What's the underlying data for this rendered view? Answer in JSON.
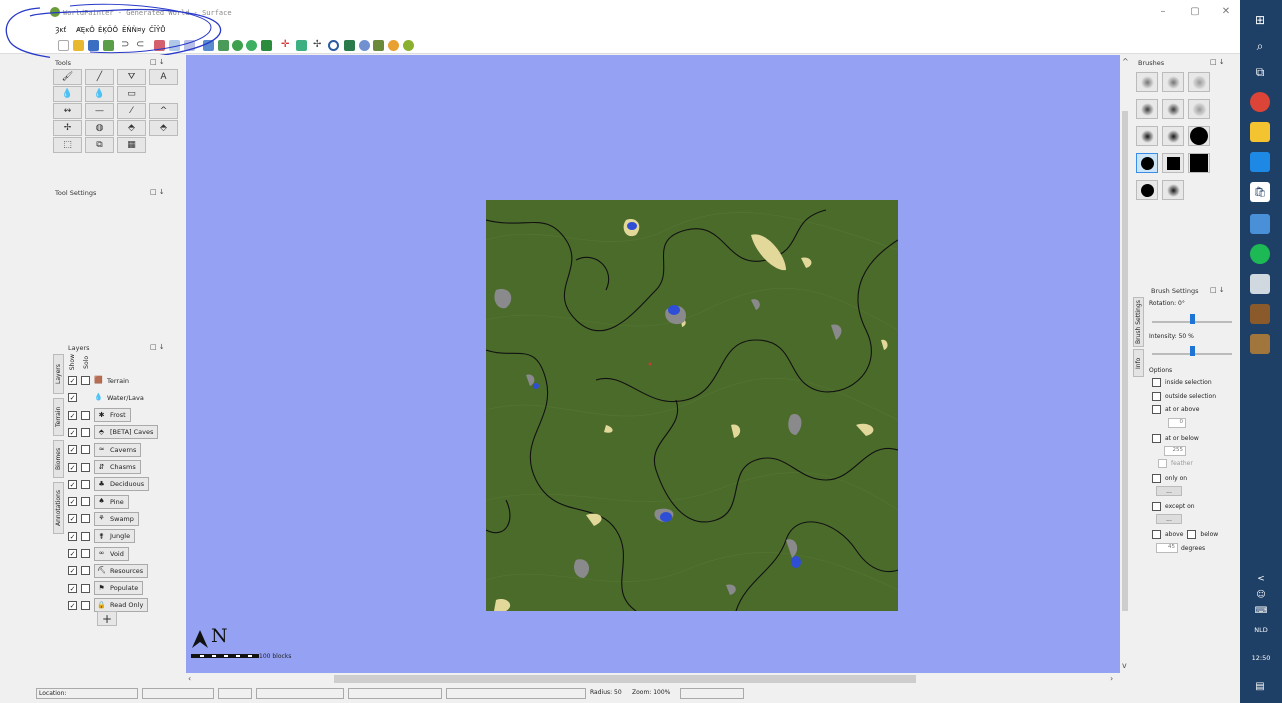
{
  "window": {
    "title": "WorldPainter - Generated World - Surface",
    "controls": [
      "–",
      "▢",
      "✕"
    ]
  },
  "menu": [
    "Ȝĸť",
    "ȺĘĸȎ",
    "ĚĶÕȎ",
    "ĔŃŇ¤y",
    "ČĪŶŮ"
  ],
  "panels": {
    "tools_title": "Tools",
    "tool_settings_title": "Tool Settings",
    "layers_title": "Layers",
    "brushes_title": "Brushes",
    "brush_settings_title": "Brush Settings",
    "panel_controls": "□ ↓"
  },
  "tools": [
    [
      "🖌",
      "╱",
      "⛛",
      "A"
    ],
    [
      "💧",
      "💧",
      "▭"
    ],
    [
      "↭",
      "—",
      "⁄",
      "^"
    ],
    [
      "✢",
      "◍",
      "⬘",
      "⬘"
    ],
    [
      "⬚",
      "⧉",
      "▦"
    ]
  ],
  "layers": {
    "column_show": "Show",
    "column_solo": "Solo",
    "items": [
      {
        "name": "Terrain",
        "icon": "🟫",
        "show": true,
        "solo": false,
        "button": false
      },
      {
        "name": "Water/Lava",
        "icon": "💧",
        "show": true,
        "solo": null,
        "button": false
      },
      {
        "name": "Frost",
        "icon": "✱",
        "show": true,
        "solo": false,
        "button": true
      },
      {
        "name": "[BETA] Caves",
        "icon": "⬘",
        "show": true,
        "solo": false,
        "button": true
      },
      {
        "name": "Caverns",
        "icon": "≈",
        "show": true,
        "solo": false,
        "button": true
      },
      {
        "name": "Chasms",
        "icon": "⇵",
        "show": true,
        "solo": false,
        "button": true
      },
      {
        "name": "Deciduous",
        "icon": "♣",
        "show": true,
        "solo": false,
        "button": true
      },
      {
        "name": "Pine",
        "icon": "♠",
        "show": true,
        "solo": false,
        "button": true
      },
      {
        "name": "Swamp",
        "icon": "⚘",
        "show": true,
        "solo": false,
        "button": true
      },
      {
        "name": "Jungle",
        "icon": "⚵",
        "show": true,
        "solo": false,
        "button": true
      },
      {
        "name": "Void",
        "icon": "∞",
        "show": true,
        "solo": false,
        "button": true
      },
      {
        "name": "Resources",
        "icon": "⛏",
        "show": true,
        "solo": false,
        "button": true
      },
      {
        "name": "Populate",
        "icon": "⚑",
        "show": true,
        "solo": false,
        "button": true
      },
      {
        "name": "Read Only",
        "icon": "🔒",
        "show": true,
        "solo": false,
        "button": true
      }
    ],
    "add_label": "+",
    "side_tabs": [
      "Layers",
      "Terrain",
      "Biomes",
      "Annotations"
    ]
  },
  "canvas": {
    "compass": "N",
    "scale_label": "100 blocks",
    "background": "#95a2f4",
    "map_green": "#4a6b2a"
  },
  "brush_settings": {
    "rotation": "Rotation: 0°",
    "intensity": "Intensity: 50 %",
    "rotation_level": 0.5,
    "intensity_level": 0.5,
    "options_title": "Options",
    "side_tabs": [
      "Brush Settings",
      "Info"
    ],
    "inside_selection": "inside selection",
    "outside_selection": "outside selection",
    "at_or_above": "at or above",
    "at_or_above_value": "0",
    "at_or_below": "at or below",
    "at_or_below_value": "255",
    "feather": "feather",
    "only_on": "only on",
    "except_on": "except on",
    "ellipsis": "...",
    "above": "above",
    "below": "below",
    "degrees_value": "45",
    "degrees": "degrees"
  },
  "status": {
    "location": "Location:",
    "radius": "Radius: 50",
    "zoom": "Zoom: 100%"
  },
  "taskbar": {
    "lang": "NLD",
    "time": "12:50",
    "chevron": "<"
  }
}
